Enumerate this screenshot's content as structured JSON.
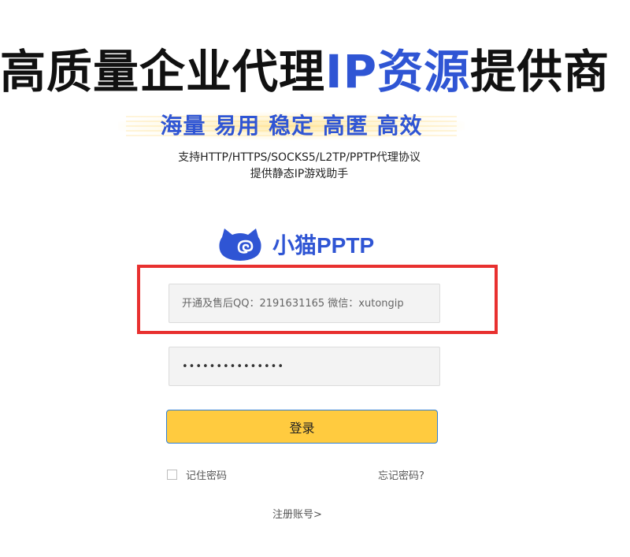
{
  "headline": {
    "part1": "高质量企业代理",
    "part2": "IP资源",
    "part3": "提供商"
  },
  "slogan": "海量 易用 稳定 高匿 高效",
  "subtitle": {
    "line1": "支持HTTP/HTTPS/SOCKS5/L2TP/PPTP代理协议",
    "line2": "提供静态IP游戏助手"
  },
  "brand": {
    "icon": "cat-cloud-logo",
    "name": "小猫PPTP"
  },
  "login": {
    "username_placeholder": "开通及售后QQ：2191631165 微信：xutongip",
    "username_value": "",
    "password_value": "•••••••••••••••",
    "button_label": "登录",
    "remember_label": "记住密码",
    "remember_checked": false,
    "forgot_label": "忘记密码?",
    "register_label": "注册账号>"
  },
  "colors": {
    "accent_blue": "#2f55d4",
    "button_yellow": "#ffcb3f",
    "highlight_red": "#e8302f"
  }
}
